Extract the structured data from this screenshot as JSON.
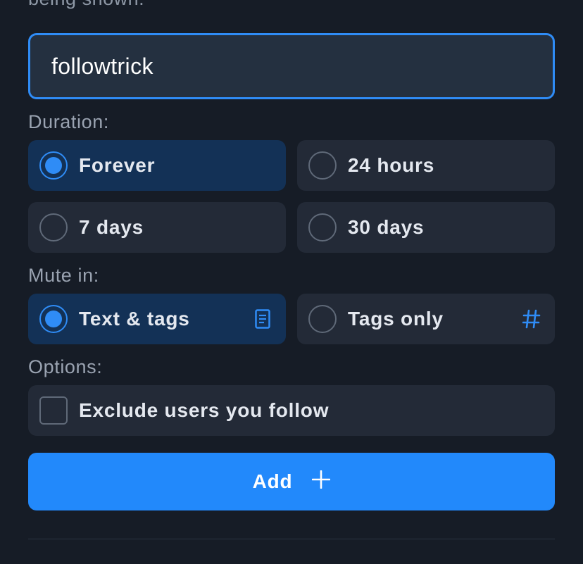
{
  "intro_text": "being shown.",
  "search": {
    "value": "followtrick"
  },
  "duration": {
    "label": "Duration:",
    "options": [
      {
        "label": "Forever",
        "selected": true
      },
      {
        "label": "24 hours",
        "selected": false
      },
      {
        "label": "7 days",
        "selected": false
      },
      {
        "label": "30 days",
        "selected": false
      }
    ]
  },
  "mute_in": {
    "label": "Mute in:",
    "options": [
      {
        "label": "Text & tags",
        "selected": true,
        "icon": "document-icon"
      },
      {
        "label": "Tags only",
        "selected": false,
        "icon": "hashtag-icon"
      }
    ]
  },
  "options": {
    "label": "Options:",
    "exclude_label": "Exclude users you follow",
    "exclude_checked": false
  },
  "add_button": {
    "label": "Add",
    "icon": "plus-icon"
  },
  "colors": {
    "background": "#161c26",
    "accent": "#2f8cf6",
    "button": "#2289fb",
    "option_bg": "#232a37",
    "option_selected_bg": "#133156"
  }
}
